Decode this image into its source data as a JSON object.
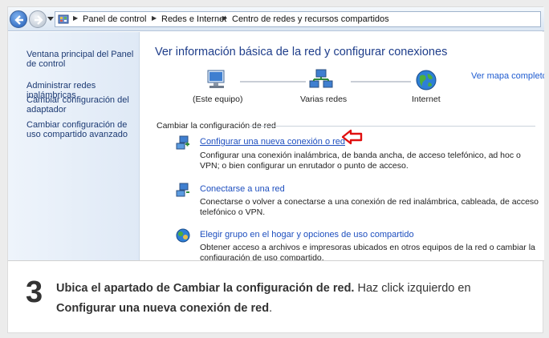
{
  "breadcrumb": [
    "Panel de control",
    "Redes e Internet",
    "Centro de redes y recursos compartidos"
  ],
  "sidebar": {
    "items": [
      {
        "label": "Ventana principal del Panel de control"
      },
      {
        "label": "Administrar redes inalámbricas"
      },
      {
        "label": "Cambiar configuración del adaptador"
      },
      {
        "label": "Cambiar configuración de uso compartido avanzado"
      }
    ]
  },
  "main": {
    "title": "Ver información básica de la red y configurar conexiones",
    "map_link": "Ver mapa completo",
    "network_map": [
      {
        "label": "(Este equipo)",
        "icon": "computer-icon"
      },
      {
        "label": "Varias redes",
        "icon": "network-icon"
      },
      {
        "label": "Internet",
        "icon": "globe-icon"
      }
    ],
    "section_title": "Cambiar la configuración de red",
    "tasks": [
      {
        "link": "Configurar una nueva conexión o red",
        "desc": "Configurar una conexión inalámbrica, de banda ancha, de acceso telefónico, ad hoc o VPN; o bien configurar un enrutador o punto de acceso."
      },
      {
        "link": "Conectarse a una red",
        "desc": "Conectarse o volver a conectarse a una conexión de red inalámbrica, cableada, de acceso telefónico o VPN."
      },
      {
        "link": "Elegir grupo en el hogar y opciones de uso compartido",
        "desc": "Obtener acceso a archivos e impresoras ubicados en otros equipos de la red o cambiar la configuración de uso compartido."
      }
    ]
  },
  "caption": {
    "step": "3",
    "bold1": "Ubica el apartado de Cambiar la configuración de red.",
    "text1": " Haz click izquierdo en ",
    "bold2": "Configurar una nueva conexión de red",
    "text2": "."
  },
  "colors": {
    "link": "#1e4fbf",
    "title": "#1e3d8a",
    "arrow": "#e01010"
  }
}
